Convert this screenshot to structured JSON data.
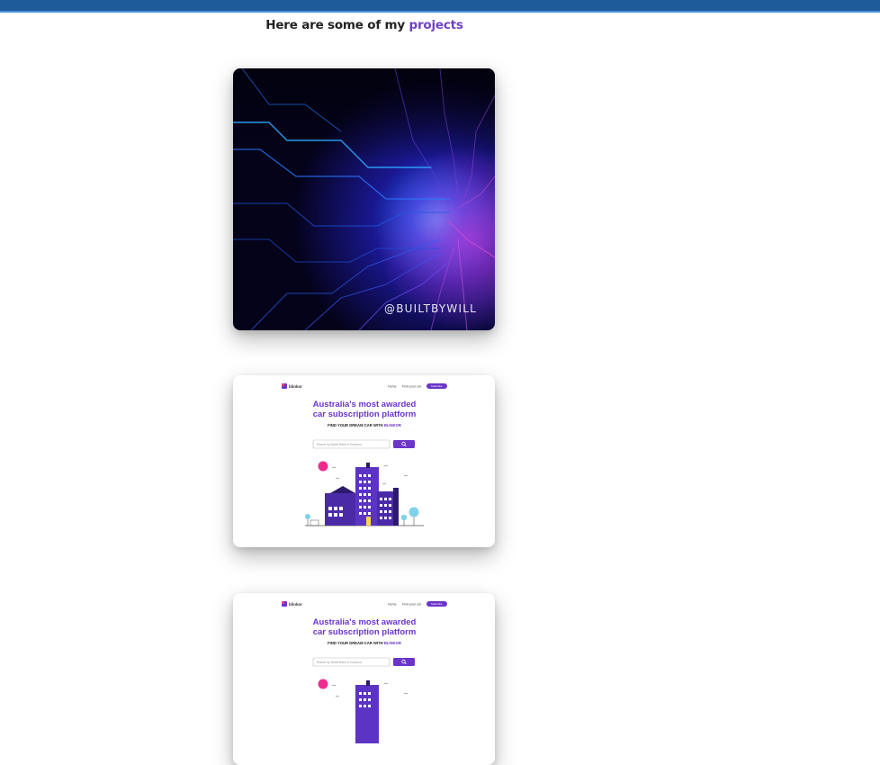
{
  "header": {
    "prefix": "Here are some of my ",
    "accent": "projects"
  },
  "projects": [
    {
      "watermark": "@BUILTBYWILL"
    },
    {
      "logo": "blinkor",
      "nav_home": "Home",
      "nav_find": "Find your car",
      "nav_button": "Subscribe",
      "title_line1": "Australia's most awarded",
      "title_line2": "car subscription platform",
      "subtitle_main": "FIND YOUR DREAM CAR WITH ",
      "subtitle_brand": "BLINKOR",
      "search_placeholder": "Search by Model Make or Keyword"
    },
    {
      "logo": "blinkor",
      "nav_home": "Home",
      "nav_find": "Find your car",
      "nav_button": "Subscribe",
      "title_line1": "Australia's most awarded",
      "title_line2": "car subscription platform",
      "subtitle_main": "FIND YOUR DREAM CAR WITH ",
      "subtitle_brand": "BLINKOR",
      "search_placeholder": "Search by Model Make or Keyword"
    }
  ]
}
